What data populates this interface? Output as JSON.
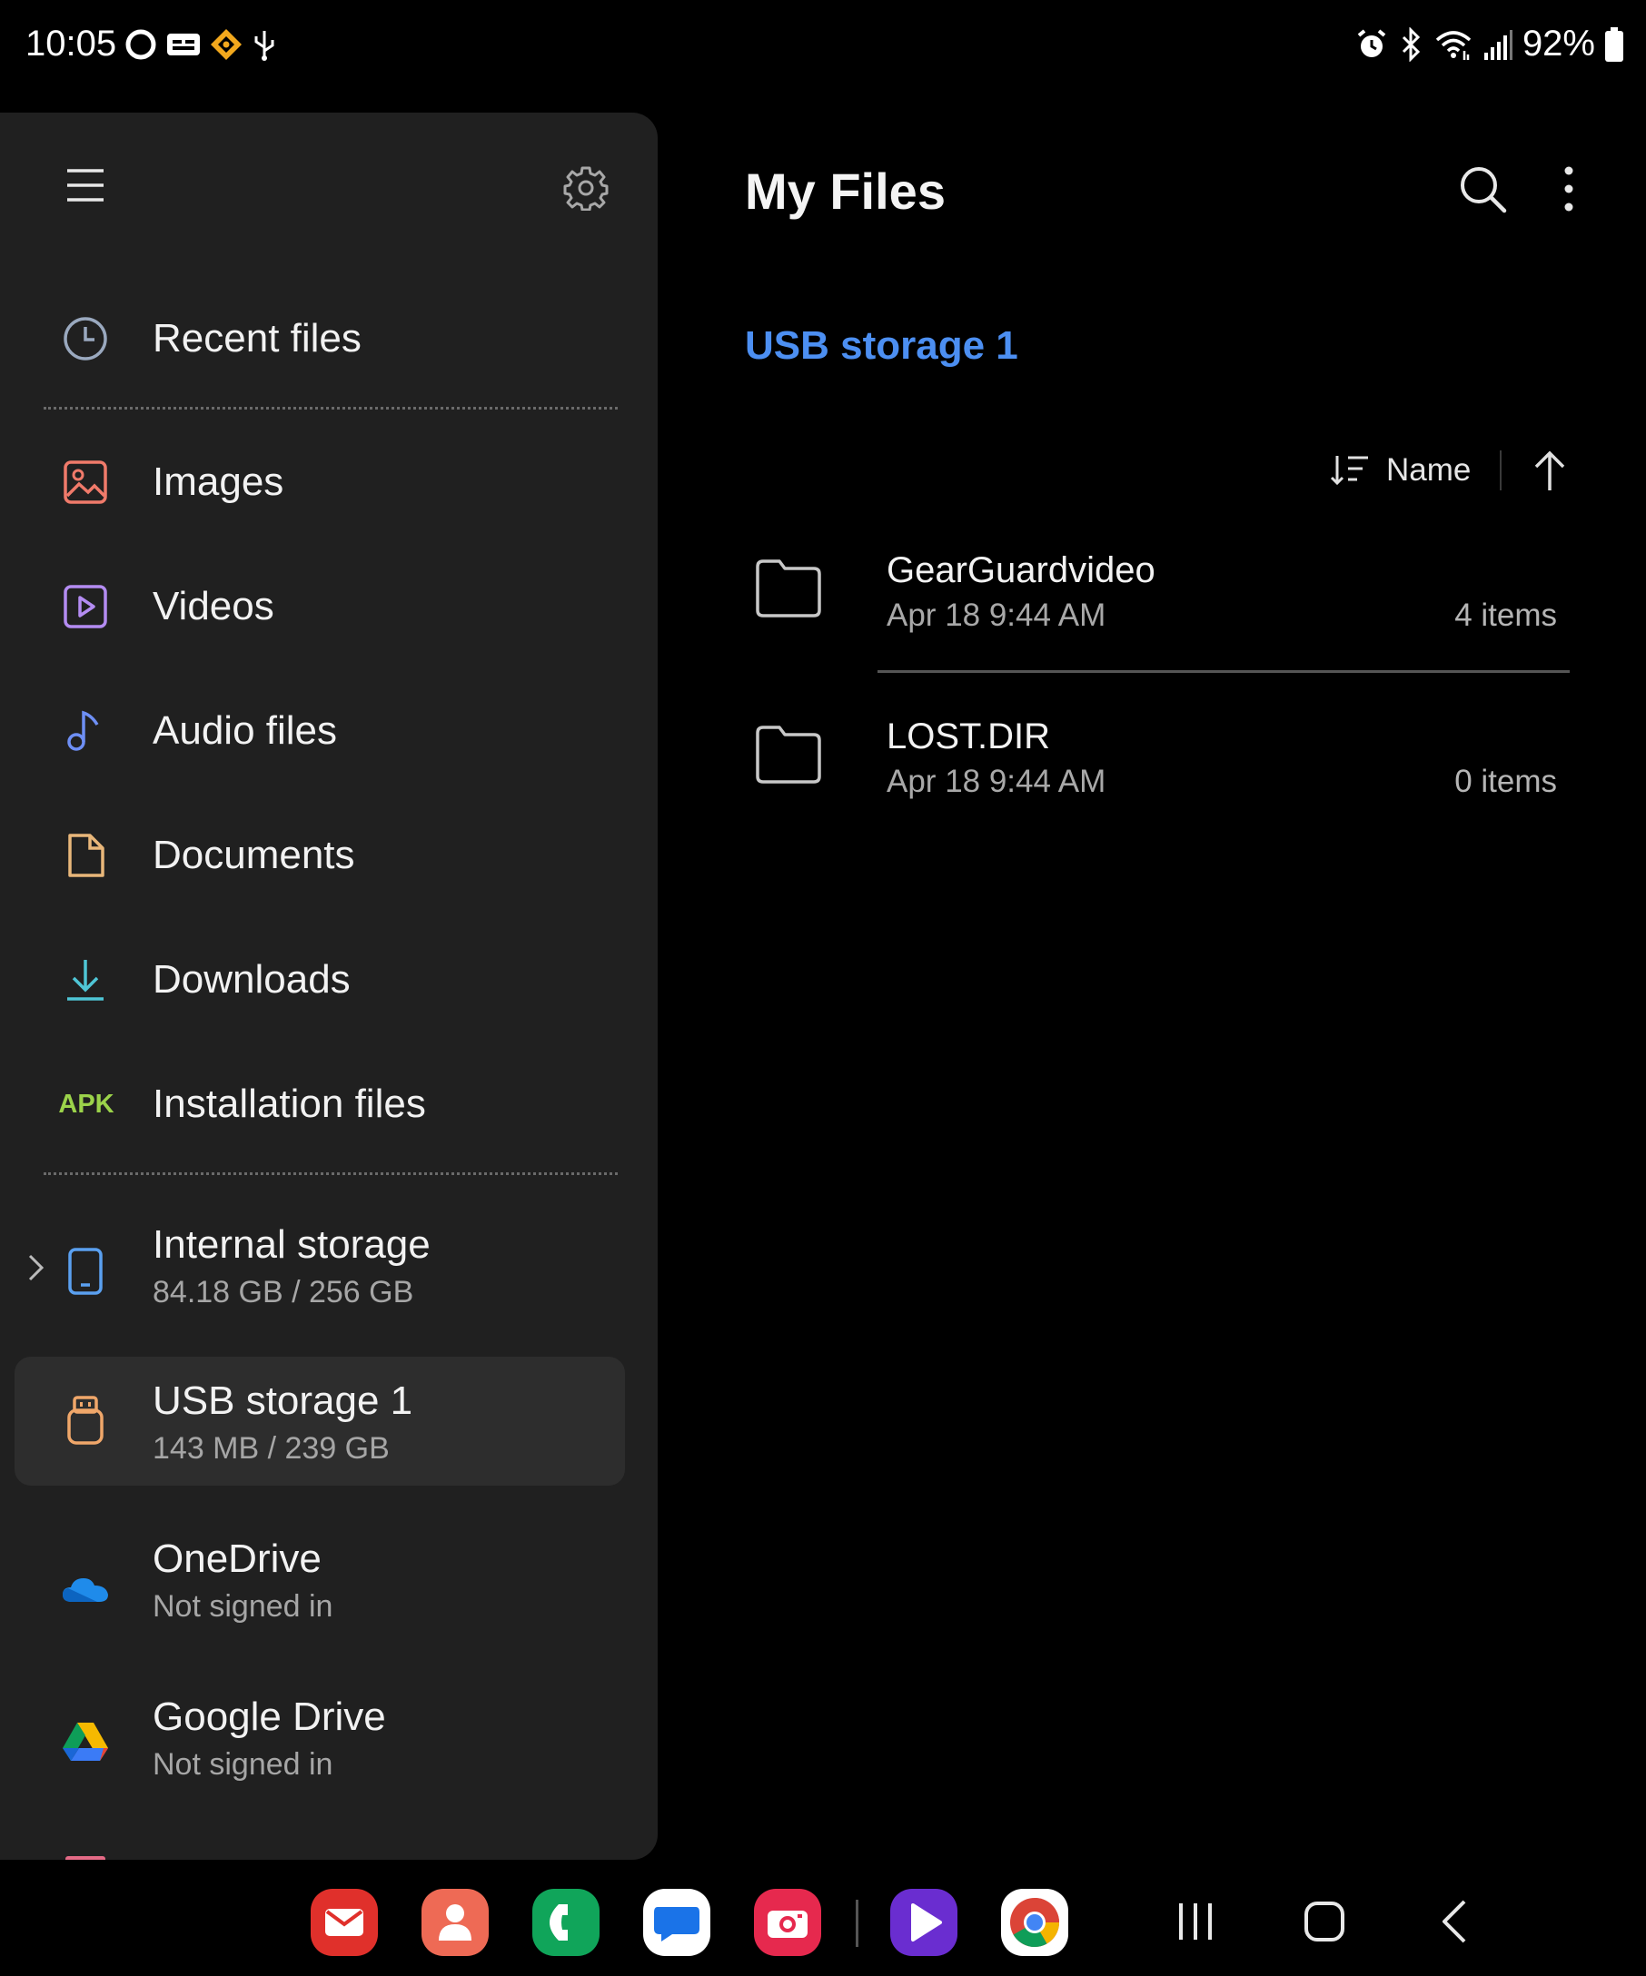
{
  "status_bar": {
    "time": "10:05",
    "battery": "92%",
    "left_icons": [
      "sync-icon",
      "caption-icon",
      "diamond-app-icon",
      "usb-icon"
    ],
    "right_icons": [
      "alarm-icon",
      "bluetooth-icon",
      "wifi-icon",
      "signal-icon",
      "battery-icon"
    ]
  },
  "drawer": {
    "menu_icon": "hamburger-icon",
    "settings_icon": "gear-icon",
    "categories": [
      {
        "label": "Recent files",
        "icon": "clock-icon",
        "color": "#9aa9bf"
      },
      {
        "label": "Images",
        "icon": "image-icon",
        "color": "#f07a6a"
      },
      {
        "label": "Videos",
        "icon": "video-icon",
        "color": "#b48cf2"
      },
      {
        "label": "Audio files",
        "icon": "music-icon",
        "color": "#6e8ff5"
      },
      {
        "label": "Documents",
        "icon": "document-icon",
        "color": "#e9b77a"
      },
      {
        "label": "Downloads",
        "icon": "download-icon",
        "color": "#4fc6d6"
      },
      {
        "label": "Installation files",
        "icon": "apk-icon",
        "icon_text": "APK",
        "color": "#9bd34a"
      }
    ],
    "storage": [
      {
        "label": "Internal storage",
        "sub": "84.18 GB / 256 GB",
        "icon": "phone-icon",
        "color": "#5aa0f0"
      },
      {
        "label": "USB storage 1",
        "sub": "143 MB / 239 GB",
        "icon": "usb-drive-icon",
        "color": "#f0a76a",
        "selected": true
      },
      {
        "label": "OneDrive",
        "sub": "Not signed in",
        "icon": "onedrive-icon",
        "color": "#1f8bea"
      },
      {
        "label": "Google Drive",
        "sub": "Not signed in",
        "icon": "google-drive-icon"
      }
    ]
  },
  "main": {
    "title": "My Files",
    "breadcrumb": "USB storage 1",
    "sort": {
      "label": "Name",
      "direction": "ascending"
    },
    "files": [
      {
        "name": "GearGuardvideo",
        "date": "Apr 18 9:44 AM",
        "count": "4 items",
        "icon": "folder-icon"
      },
      {
        "name": "LOST.DIR",
        "date": "Apr 18 9:44 AM",
        "count": "0 items",
        "icon": "folder-icon"
      }
    ]
  },
  "dock": {
    "apps": [
      {
        "name": "email-app-icon",
        "color": "#e0302b"
      },
      {
        "name": "contacts-app-icon",
        "color": "#ee6a55"
      },
      {
        "name": "phone-app-icon",
        "color": "#10a55a"
      },
      {
        "name": "messages-app-icon",
        "color": "#ffffff"
      },
      {
        "name": "camera-app-icon",
        "color": "#e6294e"
      },
      {
        "name": "play-app-icon",
        "color": "#6a2dd0"
      },
      {
        "name": "chrome-app-icon",
        "color": "#ffffff"
      }
    ],
    "system_buttons": [
      "recents-button",
      "home-button",
      "back-button"
    ]
  }
}
